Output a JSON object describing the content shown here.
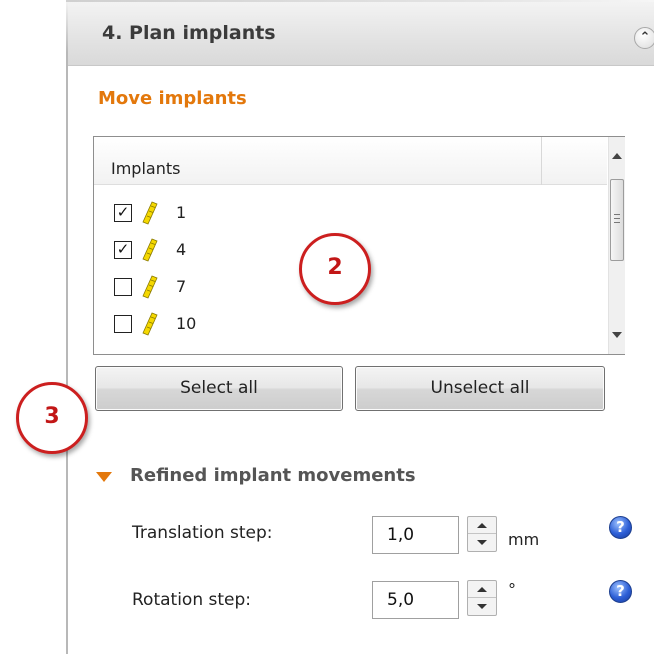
{
  "header": {
    "title": "4. Plan implants",
    "collapse_icon": "double-chevron-up"
  },
  "move_section": {
    "title": "Move implants",
    "title_color": "#e3780c"
  },
  "implant_list": {
    "column_header": "Implants",
    "items": [
      {
        "label": "1",
        "checked": true
      },
      {
        "label": "4",
        "checked": true
      },
      {
        "label": "7",
        "checked": false
      },
      {
        "label": "10",
        "checked": false
      }
    ]
  },
  "buttons": {
    "select_all": "Select all",
    "unselect_all": "Unselect all"
  },
  "refined": {
    "title": "Refined implant movements",
    "translation": {
      "label": "Translation step:",
      "value": "1,0",
      "unit": "mm"
    },
    "rotation": {
      "label": "Rotation step:",
      "value": "5,0",
      "unit": "°"
    },
    "help_icon": "?"
  },
  "callouts": {
    "two": "2",
    "three": "3",
    "color": "#cc1f1f"
  }
}
